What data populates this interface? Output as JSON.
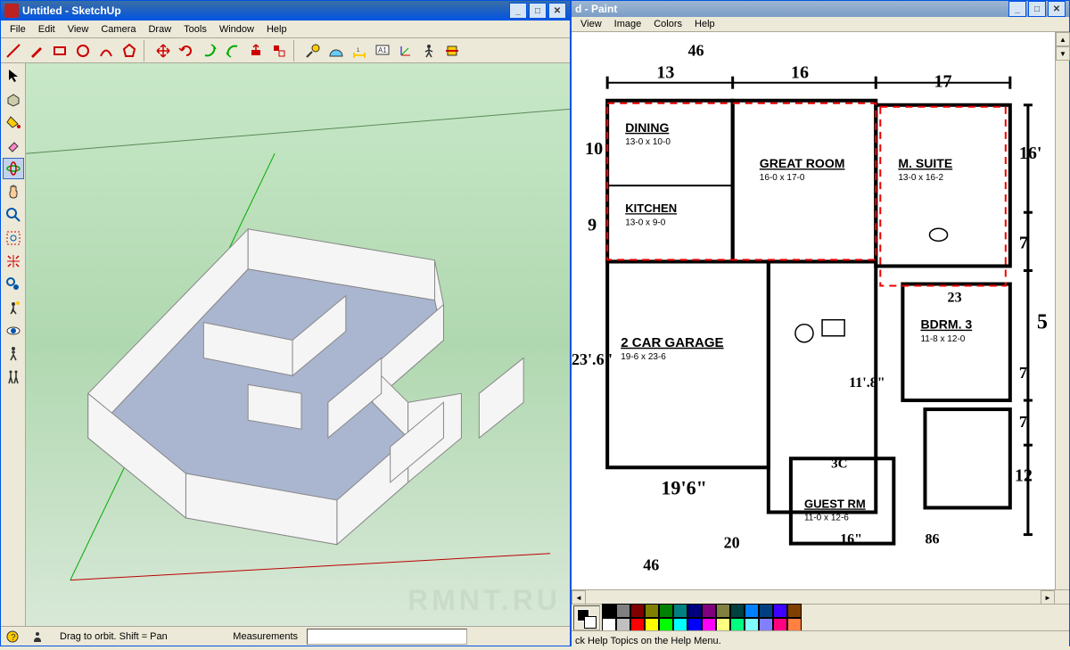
{
  "sketchup": {
    "title": "Untitled - SketchUp",
    "menus": [
      "File",
      "Edit",
      "View",
      "Camera",
      "Draw",
      "Tools",
      "Window",
      "Help"
    ],
    "status_hint": "Drag to orbit.  Shift = Pan",
    "measurements_label": "Measurements",
    "watermark": "RMNT.RU",
    "toolbar_icons": [
      "line",
      "pencil",
      "rectangle",
      "circle",
      "arc",
      "polygon",
      "move",
      "rotate",
      "scale",
      "offset",
      "pushpull",
      "followme",
      "tape",
      "protractor",
      "dimension",
      "text",
      "axes",
      "walk",
      "section"
    ],
    "side_icons": [
      "select",
      "component",
      "paint",
      "eraser",
      "orbit",
      "pan",
      "zoom",
      "zoom-extents",
      "previous",
      "next",
      "position-camera",
      "look-around",
      "walk",
      "section-plane"
    ]
  },
  "paint": {
    "title": "d - Paint",
    "menus": [
      "View",
      "Image",
      "Colors",
      "Help"
    ],
    "status": "ck Help Topics on the Help Menu.",
    "palette": [
      "#000000",
      "#808080",
      "#800000",
      "#808000",
      "#008000",
      "#008080",
      "#000080",
      "#800080",
      "#808040",
      "#004040",
      "#0080ff",
      "#004080",
      "#4000ff",
      "#804000",
      "#ffffff",
      "#c0c0c0",
      "#ff0000",
      "#ffff00",
      "#00ff00",
      "#00ffff",
      "#0000ff",
      "#ff00ff",
      "#ffff80",
      "#00ff80",
      "#80ffff",
      "#8080ff",
      "#ff0080",
      "#ff8040"
    ]
  },
  "floorplan": {
    "rooms": {
      "dining": {
        "name": "DINING",
        "dim": "13-0 x 10-0"
      },
      "greatroom": {
        "name": "GREAT ROOM",
        "dim": "16-0 x 17-0"
      },
      "msuite": {
        "name": "M. SUITE",
        "dim": "13-0 x 16-2"
      },
      "kitchen": {
        "name": "KITCHEN",
        "dim": "13-0 x 9-0"
      },
      "garage": {
        "name": "2 CAR GARAGE",
        "dim": "19-6 x 23-6"
      },
      "bdrm3": {
        "name": "BDRM. 3",
        "dim": "11-8 x 12-0"
      },
      "guestrm": {
        "name": "GUEST RM",
        "dim": "11-0 x 12-6"
      }
    },
    "handwritten": {
      "d1": "13",
      "d2": "16",
      "d3": "17",
      "d4": "10",
      "d5": "9",
      "d6": "16'",
      "d7": "23'.6\"",
      "d8": "19'6\"",
      "d9": "7",
      "d10": "5",
      "d11": "20",
      "d12": "12",
      "d13": "7",
      "d14": "46",
      "d15": "46",
      "d16": "11'.8\"",
      "d17": "3C",
      "d18": "16\"",
      "d19": "86",
      "d20": "23",
      "d21": "7"
    }
  }
}
